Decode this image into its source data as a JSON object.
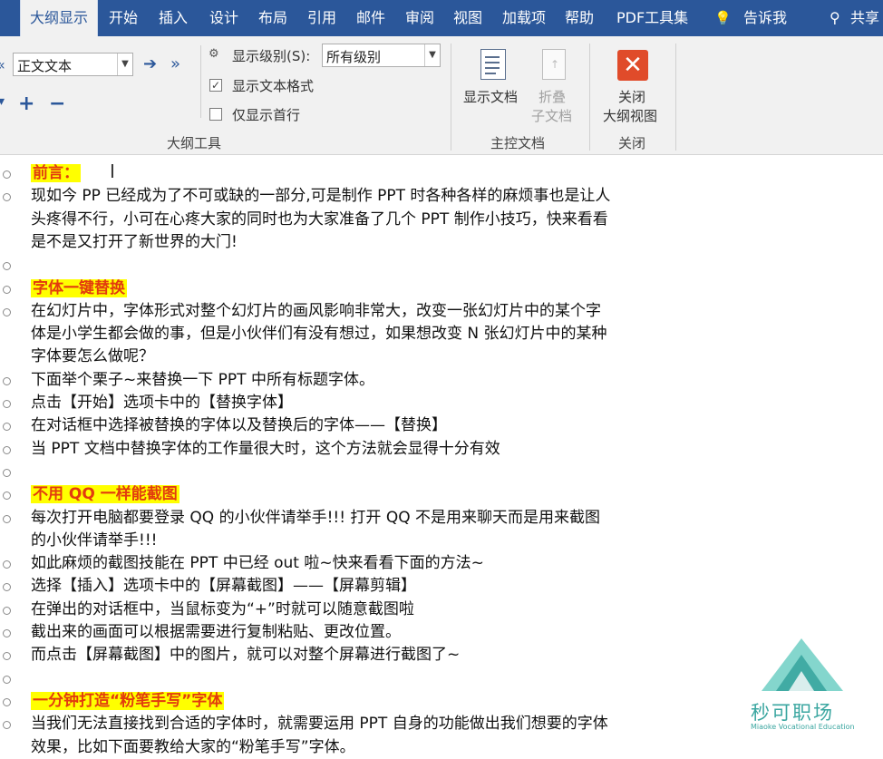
{
  "menu": {
    "tabs": [
      "大纲显示",
      "开始",
      "插入",
      "设计",
      "布局",
      "引用",
      "邮件",
      "审阅",
      "视图",
      "加载项",
      "帮助",
      "PDF工具集"
    ],
    "tell_me": "告诉我",
    "share": "共享"
  },
  "ribbon": {
    "outline_tools": {
      "level_combo_value": "正文文本",
      "show_level_label": "显示级别(S):",
      "show_level_value": "所有级别",
      "show_text_format": "显示文本格式",
      "show_text_format_checked": true,
      "show_first_line_only": "仅显示首行",
      "show_first_line_only_checked": false,
      "group_label": "大纲工具"
    },
    "master_document": {
      "show_document": "显示文档",
      "collapse_sub_line1": "折叠",
      "collapse_sub_line2": "子文档",
      "group_label": "主控文档"
    },
    "close": {
      "close_line1": "关闭",
      "close_line2": "大纲视图",
      "group_label": "关闭"
    }
  },
  "document": {
    "lines": [
      {
        "text": "前言：",
        "heading": true
      },
      {
        "text": "现如今 PP 已经成为了不可或缺的一部分,可是制作 PPT 时各种各样的麻烦事也是让人",
        "heading": false,
        "bullet": true
      },
      {
        "text": "头疼得不行，小可在心疼大家的同时也为大家准备了几个 PPT 制作小技巧，快来看看",
        "heading": false,
        "bullet": false
      },
      {
        "text": "是不是又打开了新世界的大门!",
        "heading": false,
        "bullet": false
      },
      {
        "text": "",
        "heading": false,
        "bullet": true
      },
      {
        "text": "字体一键替换",
        "heading": true
      },
      {
        "text": "在幻灯片中，字体形式对整个幻灯片的画风影响非常大，改变一张幻灯片中的某个字",
        "heading": false,
        "bullet": true
      },
      {
        "text": "体是小学生都会做的事，但是小伙伴们有没有想过，如果想改变 N 张幻灯片中的某种",
        "heading": false,
        "bullet": false
      },
      {
        "text": "字体要怎么做呢？",
        "heading": false,
        "bullet": false
      },
      {
        "text": "下面举个栗子~来替换一下 PPT 中所有标题字体。",
        "heading": false,
        "bullet": true
      },
      {
        "text": "点击【开始】选项卡中的【替换字体】",
        "heading": false,
        "bullet": true
      },
      {
        "text": "在对话框中选择被替换的字体以及替换后的字体——【替换】",
        "heading": false,
        "bullet": true
      },
      {
        "text": "当 PPT 文档中替换字体的工作量很大时，这个方法就会显得十分有效",
        "heading": false,
        "bullet": true
      },
      {
        "text": "",
        "heading": false,
        "bullet": true
      },
      {
        "text": "不用 QQ 一样能截图",
        "heading": true
      },
      {
        "text": "每次打开电脑都要登录 QQ 的小伙伴请举手!!! 打开 QQ 不是用来聊天而是用来截图",
        "heading": false,
        "bullet": true
      },
      {
        "text": "的小伙伴请举手!!!",
        "heading": false,
        "bullet": false
      },
      {
        "text": "如此麻烦的截图技能在 PPT 中已经 out 啦~快来看看下面的方法~",
        "heading": false,
        "bullet": true
      },
      {
        "text": "选择【插入】选项卡中的【屏幕截图】——【屏幕剪辑】",
        "heading": false,
        "bullet": true
      },
      {
        "text": "在弹出的对话框中，当鼠标变为“+”时就可以随意截图啦",
        "heading": false,
        "bullet": true
      },
      {
        "text": "截出来的画面可以根据需要进行复制粘贴、更改位置。",
        "heading": false,
        "bullet": true
      },
      {
        "text": "而点击【屏幕截图】中的图片，就可以对整个屏幕进行截图了~",
        "heading": false,
        "bullet": true
      },
      {
        "text": "",
        "heading": false,
        "bullet": true
      },
      {
        "text": "一分钟打造“粉笔手写”字体",
        "heading": true
      },
      {
        "text": "当我们无法直接找到合适的字体时，就需要运用 PPT 自身的功能做出我们想要的字体",
        "heading": false,
        "bullet": true
      },
      {
        "text": "效果，比如下面要教给大家的“粉笔手写”字体。",
        "heading": false,
        "bullet": false
      }
    ]
  },
  "watermark": {
    "brand": "秒可职场",
    "subtitle": "Miaoke Vocational Education"
  }
}
